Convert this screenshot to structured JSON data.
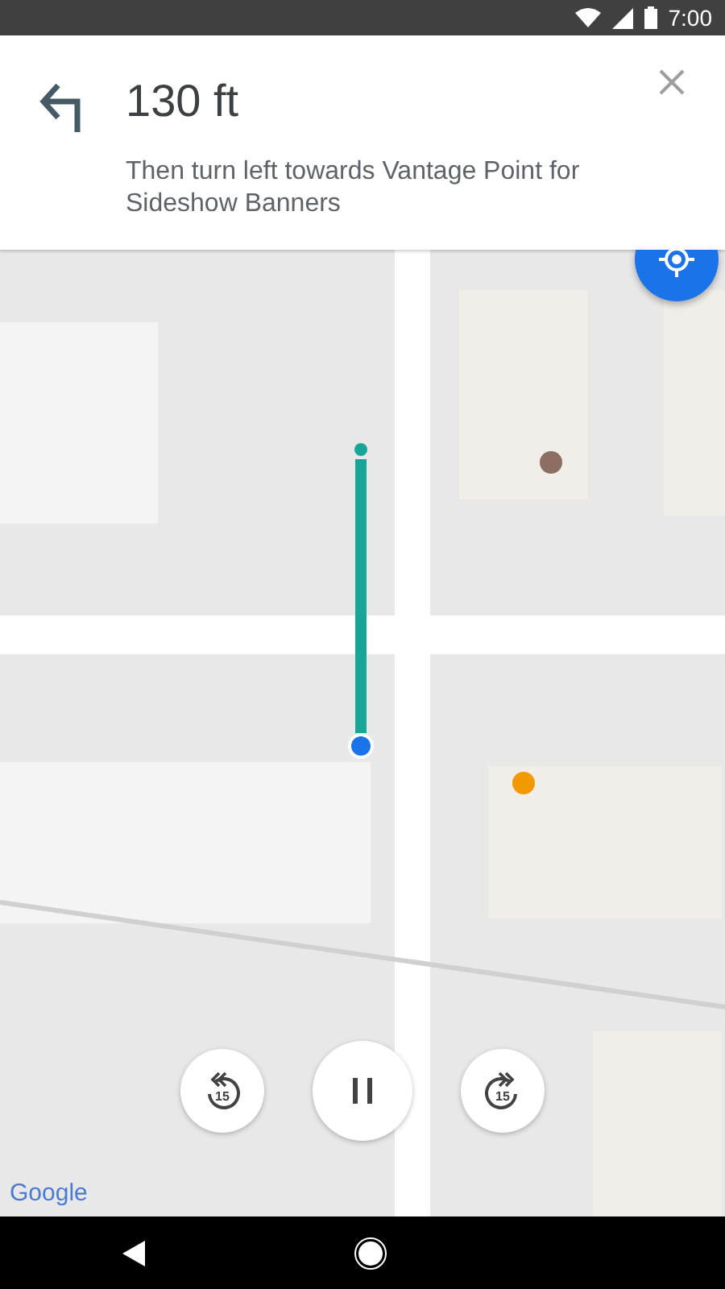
{
  "status_bar": {
    "time": "7:00"
  },
  "instruction": {
    "distance": "130 ft",
    "next_step": "Then turn left towards Vantage Point for Sideshow Banners"
  },
  "map": {
    "kind": "picture",
    "attribution": "Google"
  },
  "controls": [
    {
      "kind": "back",
      "label": "15"
    },
    {
      "kind": "pause"
    },
    {
      "kind": "forward",
      "label": "15"
    }
  ]
}
